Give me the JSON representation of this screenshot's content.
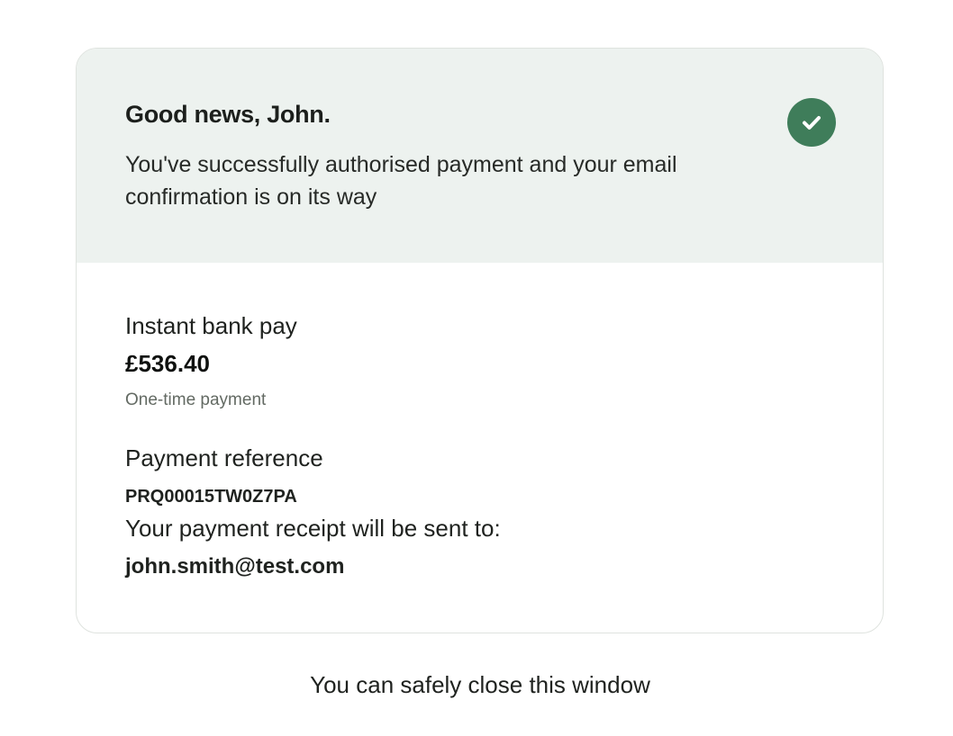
{
  "header": {
    "title": "Good news, John.",
    "message": "You've successfully authorised payment and your email confirmation is on its way",
    "status_icon": "check-circle-icon",
    "status_color": "#3f7d5a",
    "background_color": "#edf2ef"
  },
  "payment": {
    "method": "Instant bank pay",
    "amount": "£536.40",
    "type": "One-time payment"
  },
  "reference": {
    "label": "Payment reference",
    "value": "PRQ00015TW0Z7PA"
  },
  "receipt": {
    "label": "Your payment receipt will be sent to:",
    "email": "john.smith@test.com"
  },
  "footer": {
    "note": "You can safely close this window"
  }
}
